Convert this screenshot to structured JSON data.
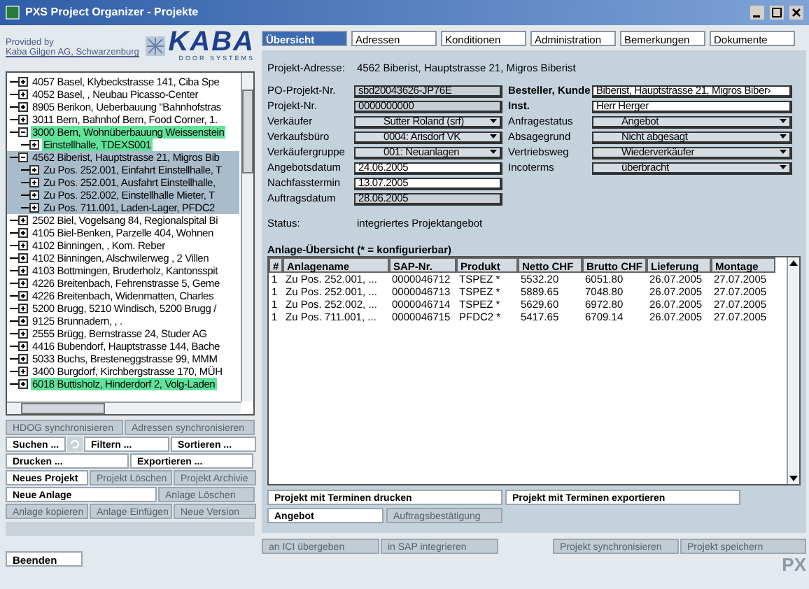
{
  "window": {
    "title": "PXS Project Organizer - Projekte"
  },
  "sidebar": {
    "provided_by": "Provided by",
    "provider": "Kaba Gilgen AG, Schwarzenburg",
    "logo": "KABA",
    "logo_tagline": "DOOR SYSTEMS",
    "tree": [
      {
        "text": "4057 Basel, Klybeckstrasse 141, Ciba Spe",
        "expanded": false,
        "selected": false
      },
      {
        "text": "4052 Basel, , Neubau Picasso-Center",
        "expanded": false,
        "selected": false
      },
      {
        "text": "8905 Berikon, Ueberbauung \"Bahnhofstras",
        "expanded": false,
        "selected": false
      },
      {
        "text": "3011 Bern, Bahnhof Bern, Food Corner, 1.",
        "expanded": false,
        "selected": false
      },
      {
        "text": "3000 Bern, Wohnüberbauung Weissenstein",
        "expanded": true,
        "selected": false,
        "color": "#5fe39a",
        "children": [
          {
            "text": "Einstellhalle, TDEXS001",
            "expanded": false,
            "selected": false,
            "color": "#5fe39a"
          }
        ]
      },
      {
        "text": "4562 Biberist, Hauptstrasse 21, Migros Bib",
        "expanded": true,
        "selected": true,
        "children": [
          {
            "text": "Zu Pos. 252.001, Einfahrt Einstellhalle, T",
            "expanded": false,
            "selected": false
          },
          {
            "text": "Zu Pos. 252.001, Ausfahrt Einstellhalle,",
            "expanded": false,
            "selected": false
          },
          {
            "text": "Zu Pos. 252.002, Einstellhalle Mieter, T",
            "expanded": false,
            "selected": false
          },
          {
            "text": "Zu Pos. 711.001, Laden-Lager, PFDC2",
            "expanded": false,
            "selected": false
          }
        ]
      },
      {
        "text": "2502 Biel, Vogelsang 84, Regionalspital Bi",
        "expanded": false,
        "selected": false
      },
      {
        "text": "4105 Biel-Benken, Parzelle 404, Wohnen",
        "expanded": false,
        "selected": false
      },
      {
        "text": "4102 Binningen, , Kom. Reber",
        "expanded": false,
        "selected": false
      },
      {
        "text": "4102 Binningen, Alschwilerweg , 2 Villen",
        "expanded": false,
        "selected": false
      },
      {
        "text": "4103 Bottmingen, Bruderholz, Kantonsspit",
        "expanded": false,
        "selected": false
      },
      {
        "text": "4226 Breitenbach, Fehrenstrasse 5, Geme",
        "expanded": false,
        "selected": false
      },
      {
        "text": "4226 Breitenbach, Widenmatten, Charles",
        "expanded": false,
        "selected": false
      },
      {
        "text": "5200 Brugg, 5210 Windisch, 5200 Brugg /",
        "expanded": false,
        "selected": false
      },
      {
        "text": "9125 Brunnadern, , .",
        "expanded": false,
        "selected": false
      },
      {
        "text": "2555 Brügg, Bernstrasse 24, Studer AG",
        "expanded": false,
        "selected": false
      },
      {
        "text": "4416 Bubendorf, Hauptstrasse 144, Bache",
        "expanded": false,
        "selected": false
      },
      {
        "text": "5033 Buchs, Bresteneggstrasse 99, MMM",
        "expanded": false,
        "selected": false
      },
      {
        "text": "3400 Burgdorf, Kirchbergstrasse 170, MÜH",
        "expanded": false,
        "selected": false
      },
      {
        "text": "6018 Buttisholz, Hinderdorf 2, Volg-Laden",
        "expanded": false,
        "selected": false,
        "color": "#5fe39a"
      }
    ],
    "button_rows": [
      [
        {
          "kind": "button",
          "label": "HDOG synchronisieren",
          "disabled": true
        },
        {
          "kind": "button",
          "label": "Adressen synchronisieren",
          "disabled": true
        }
      ],
      [
        {
          "kind": "button",
          "label": "Suchen ...",
          "disabled": false
        },
        {
          "kind": "icon",
          "disabled": false
        },
        {
          "kind": "button",
          "label": "Filtern ...",
          "disabled": false
        },
        {
          "kind": "button",
          "label": "Sortieren ...",
          "disabled": false
        }
      ],
      [
        {
          "kind": "button",
          "label": "Drucken ...",
          "disabled": false
        },
        {
          "kind": "button",
          "label": "Exportieren ...",
          "disabled": false
        }
      ],
      [
        {
          "kind": "button",
          "label": "Neues Projekt",
          "disabled": false
        },
        {
          "kind": "button",
          "label": "Projekt Löschen",
          "disabled": true
        },
        {
          "kind": "button",
          "label": "Projekt Archivie",
          "disabled": true
        }
      ],
      [
        {
          "kind": "button",
          "label": "Neue Anlage",
          "disabled": false
        },
        {
          "kind": "button",
          "label": "Anlage Löschen",
          "disabled": true
        }
      ],
      [
        {
          "kind": "button",
          "label": "Anlage kopieren",
          "disabled": true
        },
        {
          "kind": "button",
          "label": "Anlage Einfügen",
          "disabled": true
        },
        {
          "kind": "button",
          "label": "Neue Version",
          "disabled": true
        }
      ]
    ],
    "exit_button": "Beenden"
  },
  "tabs": [
    {
      "label": "Übersicht",
      "selected": true
    },
    {
      "label": "Adressen",
      "selected": false
    },
    {
      "label": "Konditionen",
      "selected": false
    },
    {
      "label": "Administration",
      "selected": false
    },
    {
      "label": "Bemerkungen",
      "selected": false
    },
    {
      "label": "Dokumente",
      "selected": false
    }
  ],
  "project_address": {
    "label": "Projekt-Adresse:",
    "value": "4562 Biberist, Hauptstrasse 21, Migros Biberist"
  },
  "form_left": [
    {
      "label": "PO-Projekt-Nr.",
      "value": "sbd20043626-JP76E",
      "kind": "readonly"
    },
    {
      "label": "Projekt-Nr.",
      "value": "0000000000",
      "kind": "readonly"
    },
    {
      "label": "Verkäufer",
      "value": "Sutter Roland (srf)",
      "kind": "select"
    },
    {
      "label": "Verkaufsbüro",
      "value": "0004: Arisdorf VK",
      "kind": "select"
    },
    {
      "label": "Verkäufergruppe",
      "value": "001: Neuanlagen",
      "kind": "select"
    },
    {
      "label": "Angebotsdatum",
      "value": "24.06.2005",
      "kind": "text"
    },
    {
      "label": "Nachfasstermin",
      "value": "13.07.2005",
      "kind": "text"
    },
    {
      "label": "Auftragsdatum",
      "value": "28.06.2005",
      "kind": "readonly"
    }
  ],
  "form_right": [
    {
      "label": "Besteller, Kunde",
      "value": "Biberist, Hauptstrasse 21, Migros Biber›",
      "kind": "text",
      "bold": true
    },
    {
      "label": "Inst.",
      "value": "Herr Herger",
      "kind": "text",
      "bold": true
    },
    {
      "label": "Anfragestatus",
      "value": "Angebot",
      "kind": "select",
      "bold": false
    },
    {
      "label": "Absagegrund",
      "value": "Nicht abgesagt",
      "kind": "select",
      "bold": false
    },
    {
      "label": "Vertriebsweg",
      "value": "Wiederverkäufer",
      "kind": "select",
      "bold": false
    },
    {
      "label": "Incoterms",
      "value": "überbracht",
      "kind": "select",
      "bold": false
    }
  ],
  "status": {
    "label": "Status:",
    "value": "integriertes Projektangebot"
  },
  "table": {
    "title": "Anlage-Übersicht (* = konfigurierbar)",
    "columns": [
      "#",
      "Anlagename",
      "SAP-Nr.",
      "Produkt",
      "Netto CHF",
      "Brutto CHF",
      "Lieferung",
      "Montage"
    ],
    "rows": [
      [
        "1",
        "Zu Pos. 252.001, ...",
        "0000046712",
        "TSPEZ *",
        "5532.20",
        "6051.80",
        "26.07.2005",
        "27.07.2005"
      ],
      [
        "1",
        "Zu Pos. 252.001, ...",
        "0000046713",
        "TSPEZ *",
        "5889.65",
        "7048.80",
        "26.07.2005",
        "27.07.2005"
      ],
      [
        "1",
        "Zu Pos. 252.002, ...",
        "0000046714",
        "TSPEZ *",
        "5629.60",
        "6972.80",
        "26.07.2005",
        "27.07.2005"
      ],
      [
        "1",
        "Zu Pos. 711.001, ...",
        "0000046715",
        "PFDC2 *",
        "5417.65",
        "6709.14",
        "26.07.2005",
        "27.07.2005"
      ]
    ]
  },
  "action_rows": [
    [
      {
        "label": "Projekt mit Terminen drucken",
        "disabled": false
      },
      {
        "label": "Projekt mit Terminen exportieren",
        "disabled": false
      }
    ],
    [
      {
        "label": "Angebot",
        "disabled": false
      },
      {
        "label": "Auftragsbestätigung",
        "disabled": true
      }
    ]
  ],
  "footer_left": [
    {
      "label": "an ICI übergeben",
      "disabled": true
    },
    {
      "label": "in SAP integrieren",
      "disabled": true
    }
  ],
  "footer_right": [
    {
      "label": "Projekt synchronisieren",
      "disabled": true
    },
    {
      "label": "Projekt speichern",
      "disabled": true
    }
  ],
  "app_logo": "PX"
}
